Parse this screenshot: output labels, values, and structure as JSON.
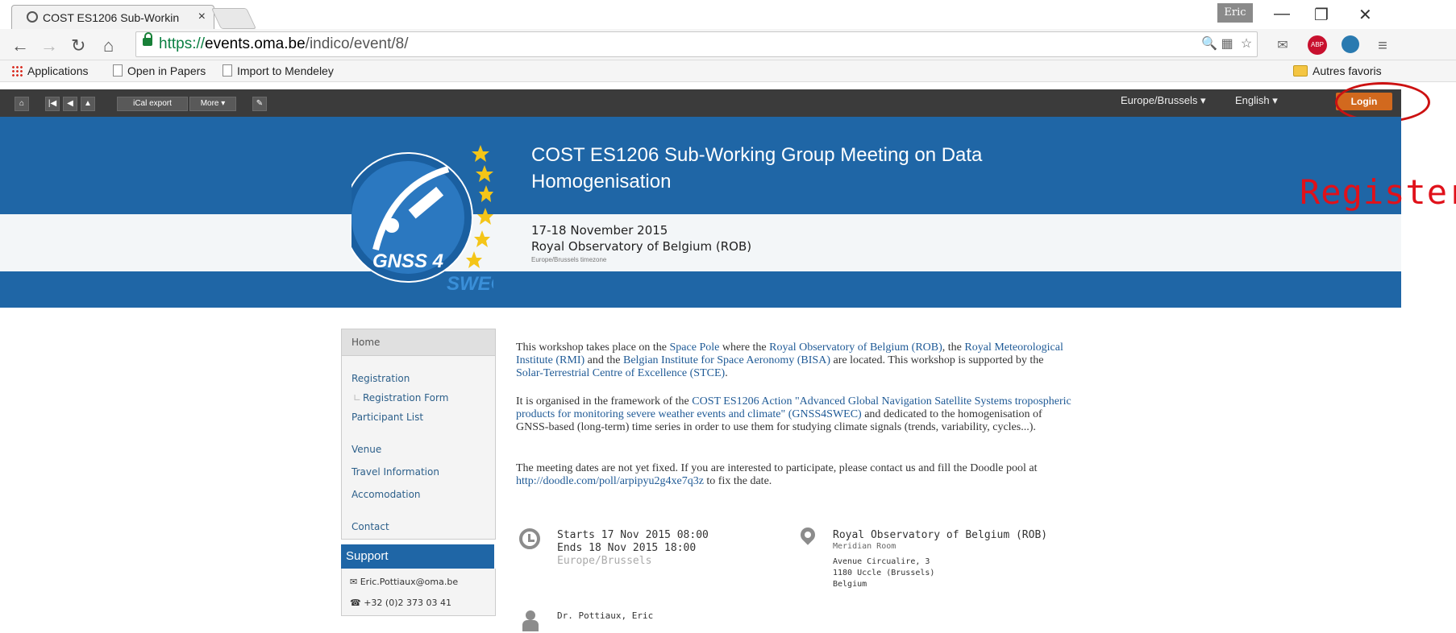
{
  "browser": {
    "tab_title": "COST ES1206 Sub-Workin",
    "tab_close": "×",
    "user_badge": "Eric",
    "url_scheme": "https://",
    "url_host": "events.oma.be",
    "url_path": "/indico/event/8/",
    "bookmarks": [
      "Applications",
      "Open in Papers",
      "Import to Mendeley"
    ],
    "other_bookmarks": "Autres favoris"
  },
  "sitebar": {
    "ical_export": "iCal export",
    "more": "More ▾",
    "timezone": "Europe/Brussels ▾",
    "language": "English ▾",
    "login": "Login"
  },
  "annotation": {
    "register": "Register"
  },
  "event": {
    "title": "COST ES1206 Sub-Working Group Meeting on Data Homogenisation",
    "dates": "17-18 November 2015",
    "venue": "Royal Observatory of Belgium (ROB)",
    "timezone_note": "Europe/Brussels timezone",
    "logo_text": "GNSS 4",
    "logo_sub": "SWEC"
  },
  "menu": {
    "home": "Home",
    "registration": "Registration",
    "registration_form": "Registration Form",
    "participant_list": "Participant List",
    "venue": "Venue",
    "travel_information": "Travel Information",
    "accomodation": "Accomodation",
    "contact": "Contact"
  },
  "support": {
    "header": "Support",
    "email": "Eric.Pottiaux@oma.be",
    "phone": "+32 (0)2 373 03 41"
  },
  "content": {
    "p1": {
      "t1": "This workshop takes place on the ",
      "l1": "Space Pole",
      "t2": " where the ",
      "l2": "Royal Observatory of Belgium (ROB)",
      "t3": ", the ",
      "l3": "Royal Meteorological Institute (RMI)",
      "t4": " and the ",
      "l4": "Belgian Institute for Space Aeronomy (BISA)",
      "t5": " are located. This workshop is supported by the ",
      "l5": "Solar-Terrestrial Centre of Excellence (STCE)",
      "t6": "."
    },
    "p2": {
      "t1": "It is organised in the framework of the ",
      "l1": "COST ES1206 Action \"Advanced Global Navigation Satellite Systems tropospheric products for monitoring severe weather events and climate\" (GNSS4SWEC)",
      "t2": " and dedicated to the homogenisation of GNSS-based (long-term) time series in order to use them for studying climate signals (trends, variability, cycles...)."
    },
    "p3": {
      "t1": "The meeting dates are not yet fixed. If you are interested to participate, please contact us and fill the Doodle pool at ",
      "l1": "http://doodle.com/poll/arpipyu2g4xe7q3z",
      "t2": " to fix the date."
    }
  },
  "details": {
    "starts_label": "Starts",
    "starts": "17 Nov 2015 08:00",
    "ends_label": "Ends",
    "ends": "18 Nov 2015 18:00",
    "tz": "Europe/Brussels",
    "location": "Royal Observatory of Belgium (ROB)",
    "room": "Meridian Room",
    "address1": "Avenue Circualire, 3",
    "address2": "1180 Uccle (Brussels)",
    "address3": "Belgium",
    "chair": "Dr. Pottiaux, Eric"
  }
}
